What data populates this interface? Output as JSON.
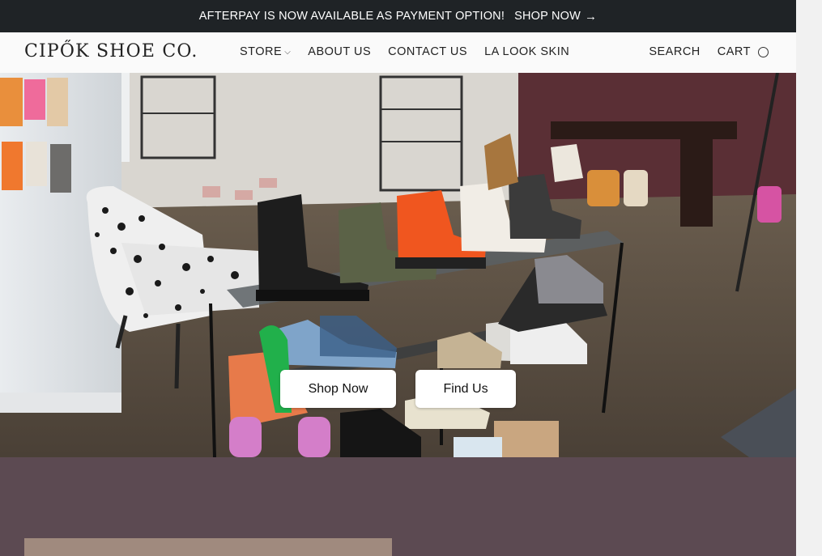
{
  "announcement": {
    "message": "AFTERPAY IS NOW AVAILABLE AS PAYMENT OPTION!",
    "link_label": "SHOP NOW",
    "arrow_icon": "arrow-right-icon",
    "background": "#1f2326"
  },
  "header": {
    "logo": "CIPŐK SHOE CO.",
    "nav": [
      {
        "label": "STORE",
        "has_dropdown": true
      },
      {
        "label": "ABOUT US"
      },
      {
        "label": "CONTACT US"
      },
      {
        "label": "LA LOOK SKIN"
      }
    ],
    "search_label": "SEARCH",
    "cart_label": "CART",
    "cart_icon": "cart-count-circle-icon"
  },
  "hero": {
    "primary_button": "Shop Now",
    "secondary_button": "Find Us"
  },
  "colors": {
    "accent_dark": "#1f2326",
    "lower_section": "#5c4a52",
    "card": "#a08a7e"
  }
}
